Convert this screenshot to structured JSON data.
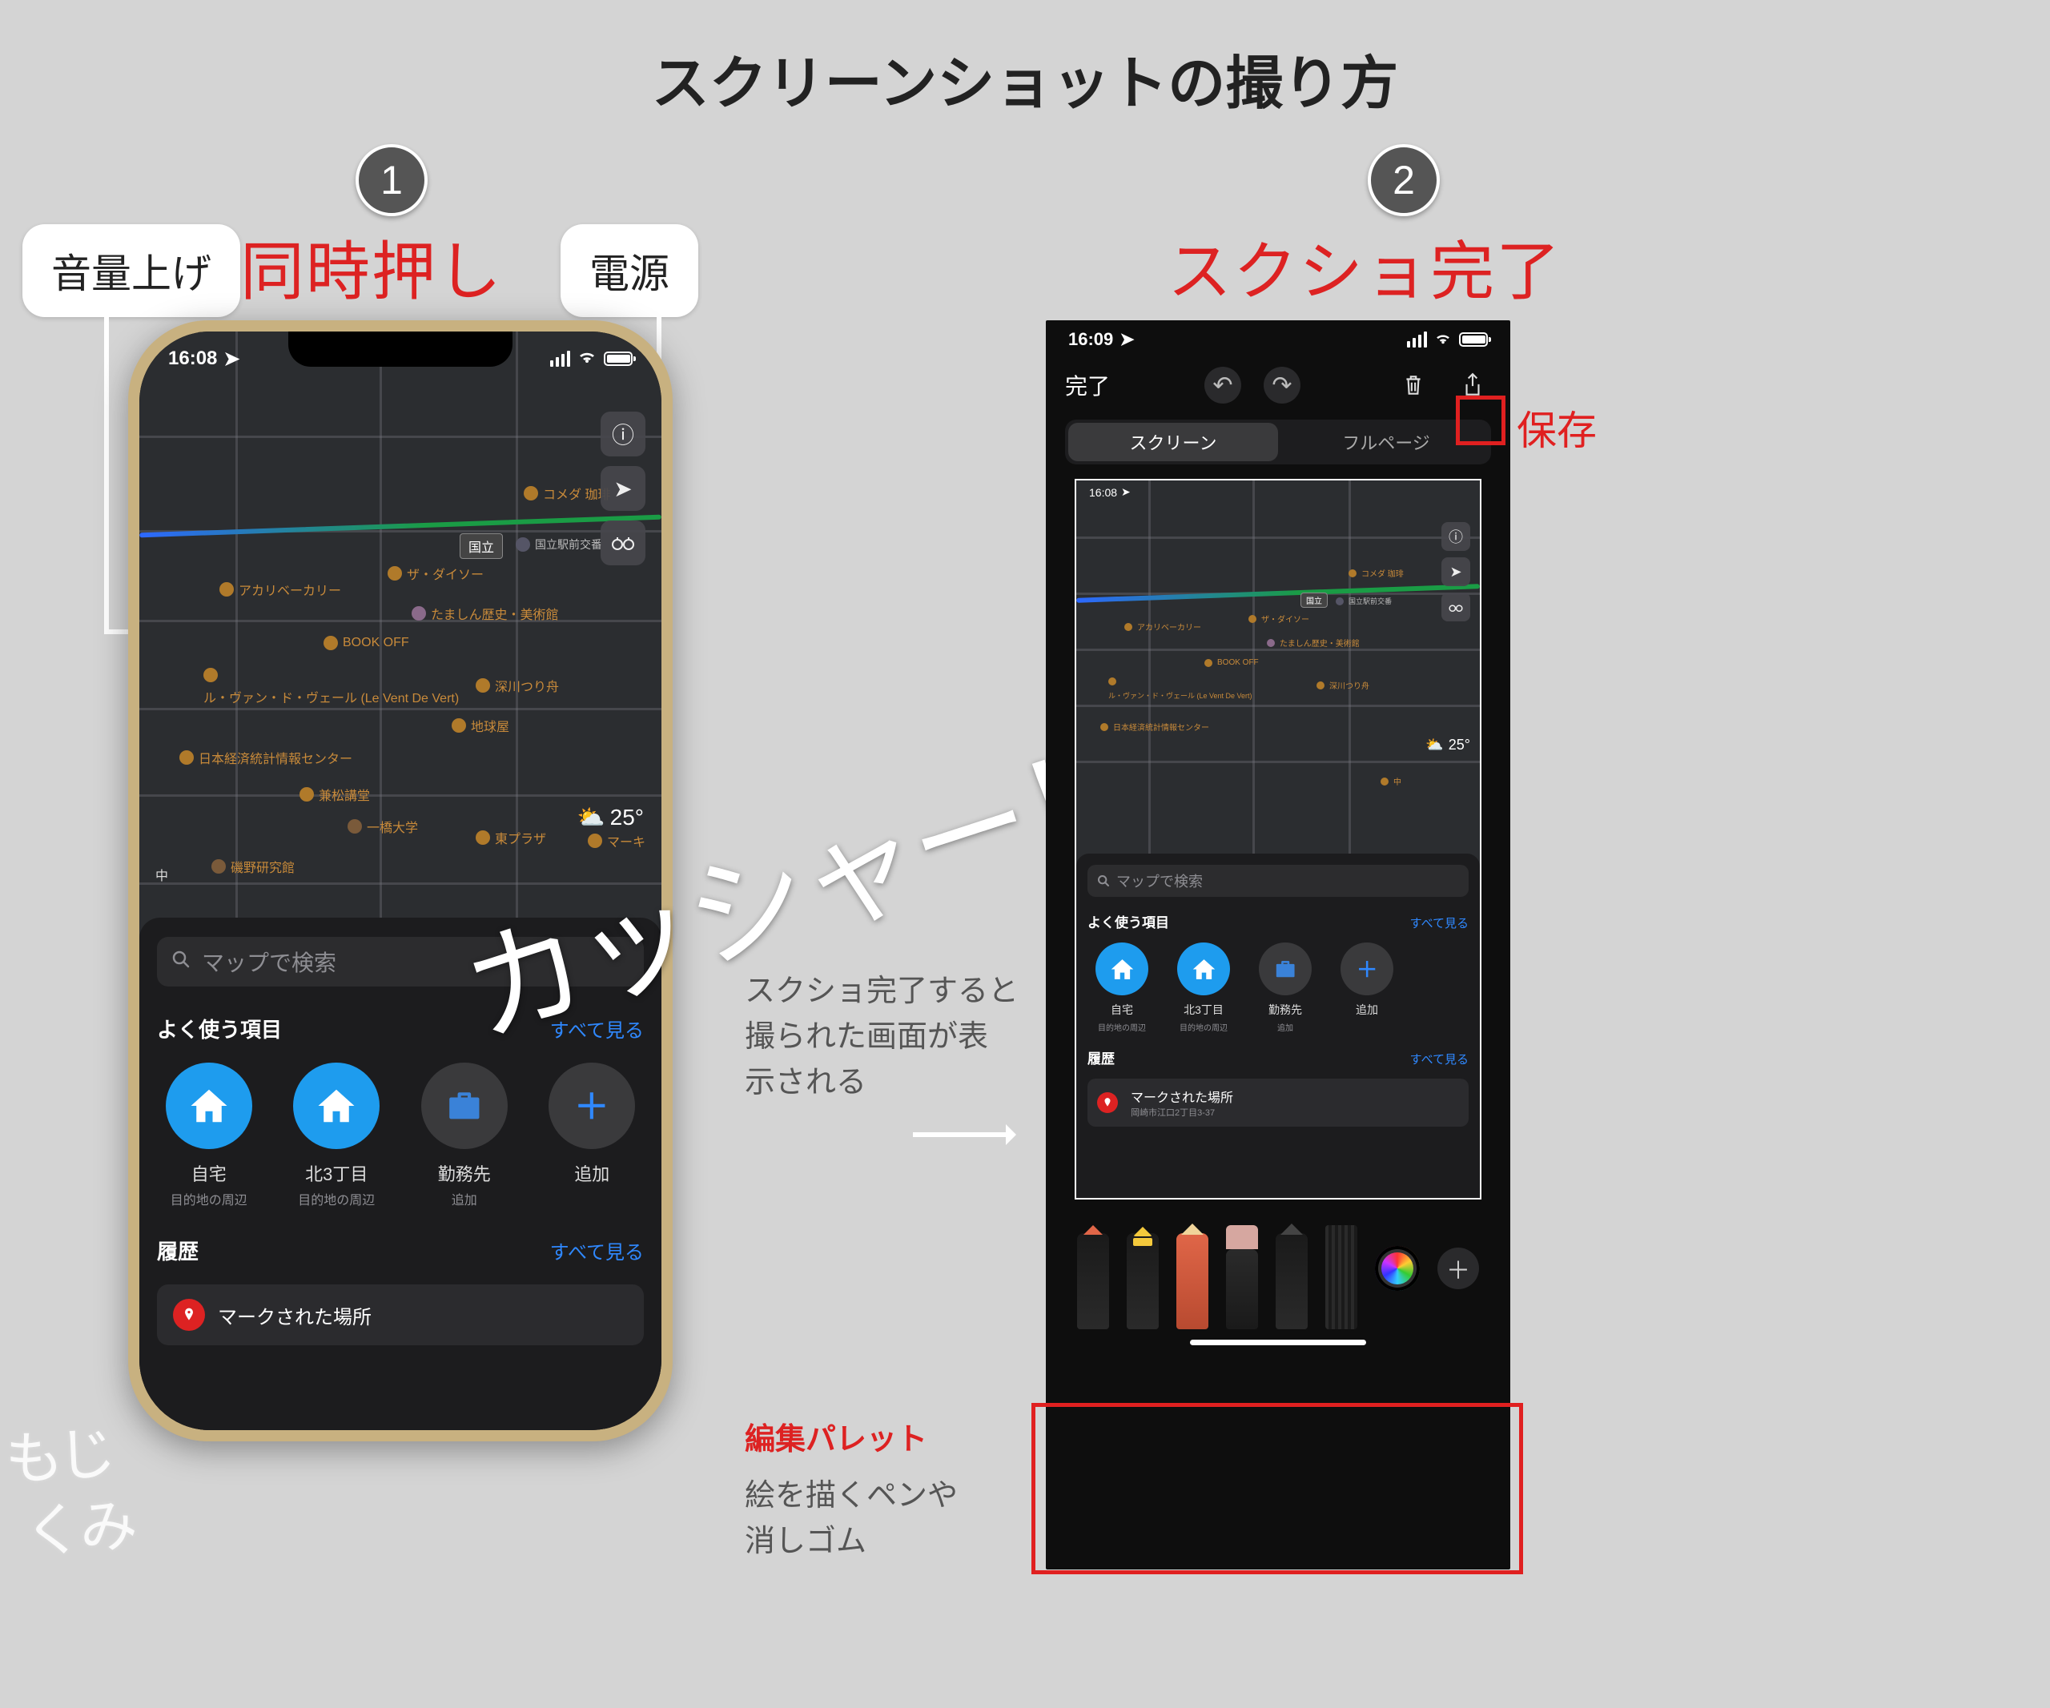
{
  "title": "スクリーンショットの撮り方",
  "step1": {
    "badge": "1",
    "heading": "同時押し",
    "label_volume": "音量上げ",
    "label_power": "電源"
  },
  "step2": {
    "badge": "2",
    "heading": "スクショ完了",
    "note_result": "スクショ完了すると\n撮られた画面が表\n示される",
    "palette_title": "編集パレット",
    "palette_note": "絵を描くペンや\n消しゴム",
    "save_label": "保存"
  },
  "sound_effect": "カッシャー！",
  "maps": {
    "time1": "16:08",
    "search_placeholder": "マップで検索",
    "section_fav": "よく使う項目",
    "section_history": "履歴",
    "see_all": "すべて見る",
    "weather_temp": "25°",
    "station1": "国立",
    "station2": "国立駅前交番",
    "poi_komeda": "コメダ 珈琲",
    "poi_akari": "アカリベーカリー",
    "poi_daiso": "ザ・ダイソー",
    "poi_tamashin": "たましん歴史・美術館",
    "poi_bookoff": "BOOK OFF",
    "poi_levain": "ル・ヴァン・ド・ヴェール (Le Vent De Vert)",
    "poi_fukagawa": "深川つり舟",
    "poi_chikyu": "地球屋",
    "poi_nikkei": "日本経済統計情報センター",
    "poi_kanematsu": "兼松講堂",
    "poi_hitotsu": "一橋大学",
    "poi_higashi": "東プラザ",
    "poi_isono": "磯野研究館",
    "poi_marki": "マーキ",
    "poi_chu": "中",
    "favs": [
      {
        "label": "自宅",
        "sub": "目的地の周辺",
        "color": "#1e9cee",
        "icon": "home"
      },
      {
        "label": "北3丁目",
        "sub": "目的地の周辺",
        "color": "#1e9cee",
        "icon": "home"
      },
      {
        "label": "勤務先",
        "sub": "追加",
        "color": "#3a3a3c",
        "icon": "briefcase"
      },
      {
        "label": "追加",
        "sub": "",
        "color": "#3a3a3c",
        "icon": "plus"
      }
    ],
    "marked_title": "マークされた場所",
    "marked_sub": "岡崎市江口2丁目3-37"
  },
  "editor": {
    "time": "16:09",
    "done": "完了",
    "tab_screen": "スクリーン",
    "tab_fullpage": "フルページ"
  },
  "watermark": "もじくみ"
}
